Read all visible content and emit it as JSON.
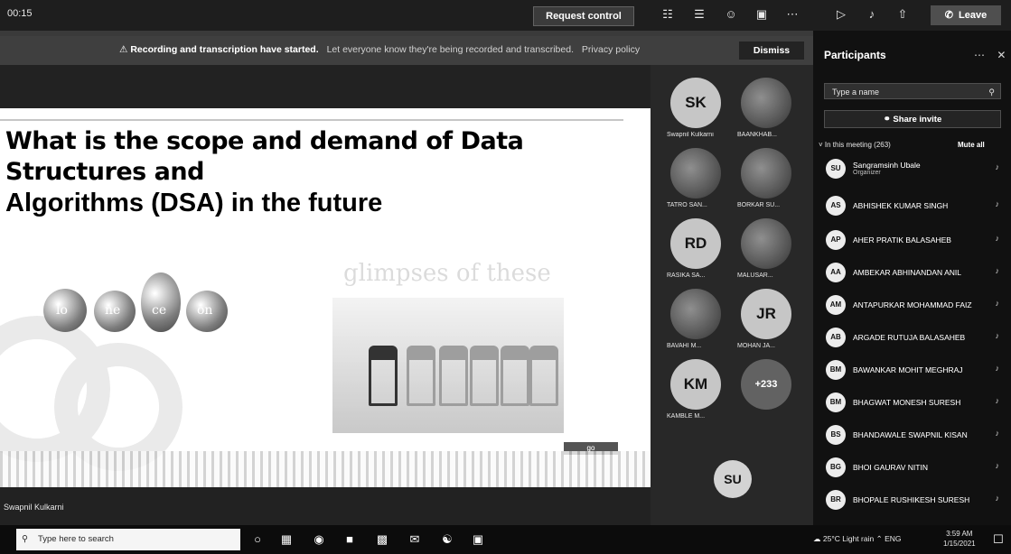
{
  "topbar": {
    "window_label": "00:15",
    "request_control": "Request control",
    "icons": [
      "chat-icon",
      "people-icon",
      "reactions-icon",
      "rooms-icon",
      "more-icon",
      "camera-icon",
      "mic-icon",
      "share-icon"
    ],
    "leave": "Leave"
  },
  "banner": {
    "bold": "Recording and transcription have started.",
    "message": "Let everyone know they're being recorded and transcribed.",
    "link": "Privacy policy",
    "dismiss": "Dismiss"
  },
  "slide": {
    "title_line1": "What is the scope and demand of Data Structures and",
    "title_line2": "Algorithms (DSA) in the future",
    "fruit_labels": [
      "lo",
      "ne",
      "ce",
      "on"
    ],
    "glimpses_text": "glimpses of these",
    "button_label": "go"
  },
  "presenter_label": "Swapnil Kulkarni",
  "gallery": {
    "tiles": [
      {
        "initials": "SK",
        "name": "Swapnil Kulkarni"
      },
      {
        "initials": "",
        "name": "BAANKHAB..."
      },
      {
        "initials": "",
        "name": "TATRO SAN..."
      },
      {
        "initials": "",
        "name": "BORKAR SU..."
      },
      {
        "initials": "RD",
        "name": "RASIKA SA..."
      },
      {
        "initials": "",
        "name": "MALUSAR..."
      },
      {
        "initials": "",
        "name": "BAVAHI M..."
      },
      {
        "initials": "JR",
        "name": "MOHAN JA..."
      },
      {
        "initials": "KM",
        "name": "KAMBLE M..."
      },
      {
        "initials": "+233",
        "name": ""
      }
    ],
    "self_initials": "SU"
  },
  "participants": {
    "title": "Participants",
    "search_placeholder": "Type a name",
    "share_invite": "Share invite",
    "section": "In this meeting (263)",
    "mute_all": "Mute all",
    "rows": [
      {
        "initials": "SU",
        "name": "Sangramsinh Ubale",
        "sub": "Organizer"
      },
      {
        "initials": "AS",
        "name": "ABHISHEK KUMAR SINGH",
        "sub": ""
      },
      {
        "initials": "AP",
        "name": "AHER PRATIK BALASAHEB",
        "sub": ""
      },
      {
        "initials": "AA",
        "name": "AMBEKAR ABHINANDAN ANIL",
        "sub": ""
      },
      {
        "initials": "AM",
        "name": "ANTAPURKAR MOHAMMAD FAIZ",
        "sub": ""
      },
      {
        "initials": "AB",
        "name": "ARGADE RUTUJA BALASAHEB",
        "sub": ""
      },
      {
        "initials": "BM",
        "name": "BAWANKAR MOHIT MEGHRAJ",
        "sub": ""
      },
      {
        "initials": "BM",
        "name": "BHAGWAT MONESH SURESH",
        "sub": ""
      },
      {
        "initials": "BS",
        "name": "BHANDAWALE SWAPNIL KISAN",
        "sub": ""
      },
      {
        "initials": "BG",
        "name": "BHOI GAURAV NITIN",
        "sub": ""
      },
      {
        "initials": "BR",
        "name": "BHOPALE RUSHIKESH SURESH",
        "sub": ""
      }
    ]
  },
  "taskbar": {
    "search_placeholder": "Type here to search",
    "tray_text": "25°C Light rain",
    "lang": "ENG",
    "time": "3:59 AM",
    "date": "1/15/2021"
  }
}
